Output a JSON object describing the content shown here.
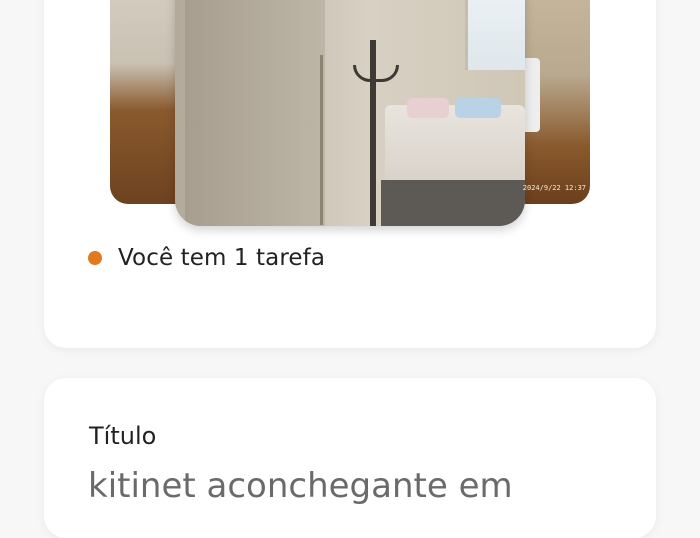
{
  "photos": {
    "timestamp": "2024/9/22 12:37"
  },
  "tasks": {
    "label": "Você tem 1 tarefa",
    "dot_color": "#e17a1c"
  },
  "title_field": {
    "label": "Título",
    "value": "kitinet aconchegante em"
  }
}
